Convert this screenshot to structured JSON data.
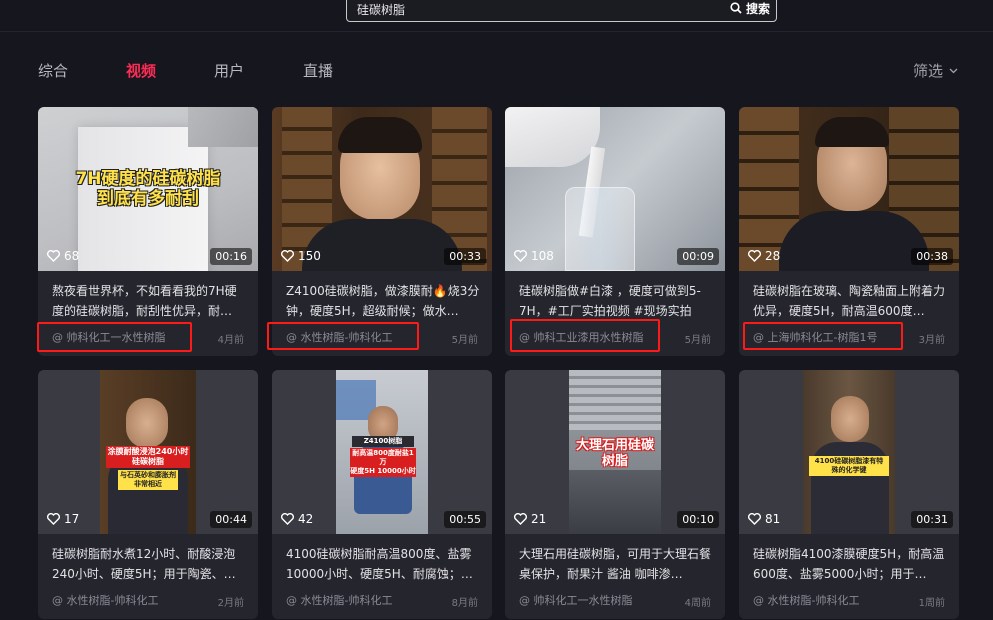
{
  "search": {
    "value": "硅碳树脂",
    "button_label": "搜索"
  },
  "tabs": [
    {
      "label": "综合"
    },
    {
      "label": "视频"
    },
    {
      "label": "用户"
    },
    {
      "label": "直播"
    }
  ],
  "active_tab": "视频",
  "filter": {
    "label": "筛选"
  },
  "colors": {
    "accent": "#fe2c55",
    "highlight_box": "#ff1a1a",
    "background": "#16161e",
    "card": "#25252e"
  },
  "cards": [
    {
      "likes": "68",
      "duration": "00:16",
      "description": "熬夜看世界杯，不如看看我的7H硬度的硅碳树脂，耐刮性优异，耐…",
      "author": "@ 帅科化工一水性树脂",
      "time": "4月前",
      "overlay": "7H硬度的硅碳树脂\n到底有多耐刮"
    },
    {
      "likes": "150",
      "duration": "00:33",
      "description": "Z4100硅碳树脂，做漆膜耐🔥烧3分钟，硬度5H，超级耐候；做水…",
      "author": "@ 水性树脂-帅科化工",
      "time": "5月前"
    },
    {
      "likes": "108",
      "duration": "00:09",
      "description": "硅碳树脂做#白漆 ，硬度可做到5-7H，#工厂实拍视频 #现场实拍 #…",
      "author": "@ 帅科工业漆用水性树脂",
      "time": "5月前"
    },
    {
      "likes": "28",
      "duration": "00:38",
      "description": "硅碳树脂在玻璃、陶瓷釉面上附着力优异，硬度5H，耐高温600度…",
      "author": "@ 上海帅科化工-树脂1号",
      "time": "3月前"
    },
    {
      "likes": "17",
      "duration": "00:44",
      "description": "硅碳树脂耐水煮12小时、耐酸浸泡240小时、硬度5H；用于陶瓷、…",
      "author": "@ 水性树脂-帅科化工",
      "time": "2月前",
      "overlay": "涂膜耐酸浸泡240小时\n硅碳树脂",
      "overlay2": "与石英砂和膨胀剂\n非常相近"
    },
    {
      "likes": "42",
      "duration": "00:55",
      "description": "4100硅碳树脂耐高温800度、盐雾10000小时、硬度5H、耐腐蚀；…",
      "author": "@ 水性树脂-帅科化工",
      "time": "8月前",
      "overlay": "Z4100树脂",
      "overlay2": "耐高温800度耐盐1万\n硬度5H 10000小时"
    },
    {
      "likes": "21",
      "duration": "00:10",
      "description": "大理石用硅碳树脂，可用于大理石餐桌保护，耐果汁 酱油 咖啡渗…",
      "author": "@ 帅科化工一水性树脂",
      "time": "4周前",
      "overlay": "大理石用硅碳\n树脂"
    },
    {
      "likes": "81",
      "duration": "00:31",
      "description": "硅碳树脂4100漆膜硬度5H，耐高温600度、盐雾5000小时；用于…",
      "author": "@ 水性树脂-帅科化工",
      "time": "1周前",
      "overlay": "4100硅碳树脂漆有特\n殊的化学键"
    }
  ]
}
